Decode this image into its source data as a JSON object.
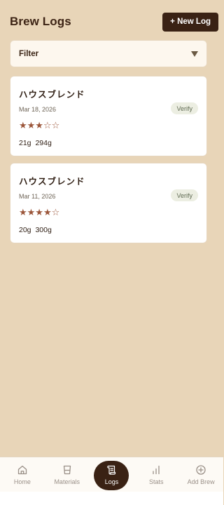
{
  "header": {
    "title": "Brew Logs",
    "new_log_label": "+ New Log"
  },
  "filter": {
    "label": "Filter"
  },
  "logs": [
    {
      "title": "ハウスブレンド",
      "date": "Mar 18, 2026",
      "badge": "Verify",
      "rating": 3,
      "rating_max": 5,
      "stars": "★★★☆☆",
      "dose": "21g",
      "water": "294g"
    },
    {
      "title": "ハウスブレンド",
      "date": "Mar 11, 2026",
      "badge": "Verify",
      "rating": 4,
      "rating_max": 5,
      "stars": "★★★★☆",
      "dose": "20g",
      "water": "300g"
    }
  ],
  "nav": {
    "items": [
      {
        "label": "Home",
        "icon": "home-icon"
      },
      {
        "label": "Materials",
        "icon": "cup-icon"
      },
      {
        "label": "Logs",
        "icon": "scroll-icon",
        "active": true
      },
      {
        "label": "Stats",
        "icon": "bar-chart-icon"
      },
      {
        "label": "Add Brew",
        "icon": "plus-circle-icon"
      }
    ]
  },
  "colors": {
    "background": "#e8d5b8",
    "primary": "#3a2214",
    "star": "#9b4f33",
    "badge_bg": "#eceee2"
  }
}
